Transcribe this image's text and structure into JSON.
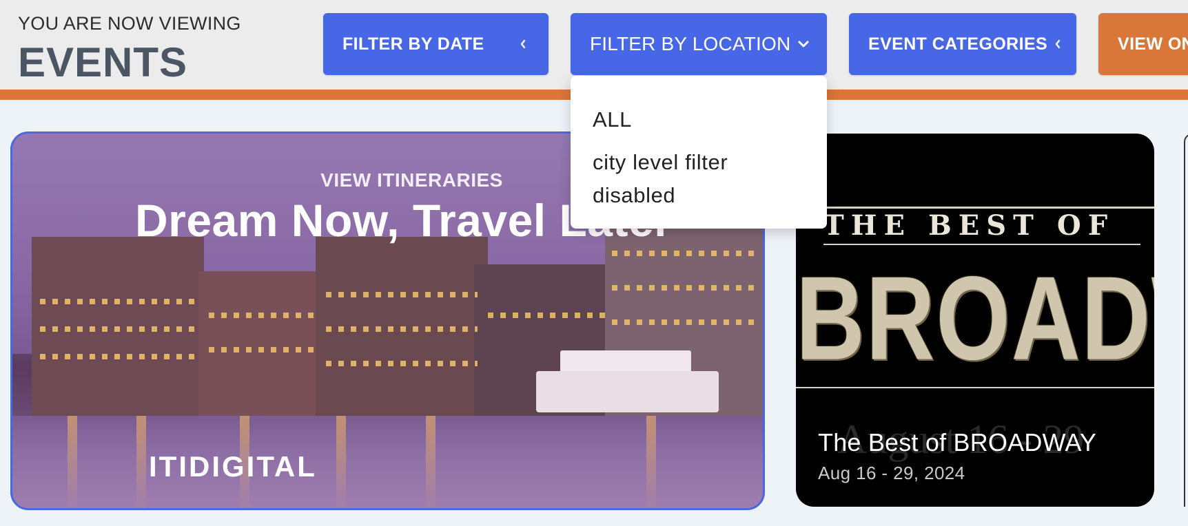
{
  "header": {
    "viewing_label": "YOU ARE NOW VIEWING",
    "title": "EVENTS",
    "accent_color": "#d9763a"
  },
  "filters": {
    "date": {
      "label": "FILTER BY DATE",
      "icon": "chevron-left-icon"
    },
    "location": {
      "label": "FILTER BY LOCATION",
      "icon": "chevron-down-icon",
      "expanded": true
    },
    "categories": {
      "label": "EVENT CATEGORIES",
      "icon": "chevron-left-icon"
    },
    "view": {
      "label": "VIEW ON"
    },
    "button_color": "#4767e6"
  },
  "location_dropdown": {
    "options": [
      "ALL",
      "city level filter disabled"
    ],
    "option_lines": [
      "city level filter",
      "disabled"
    ]
  },
  "cards": {
    "featured": {
      "subtitle": "VIEW ITINERARIES",
      "title": "Dream Now, Travel Later",
      "brand": "ITIDIGITAL"
    },
    "event": {
      "image_top_text": "THE BEST OF",
      "image_main_text": "BROADWAY",
      "image_ghost_text": "August 16 - 29",
      "title": "The Best of BROADWAY",
      "date": "Aug 16 - 29, 2024"
    }
  }
}
